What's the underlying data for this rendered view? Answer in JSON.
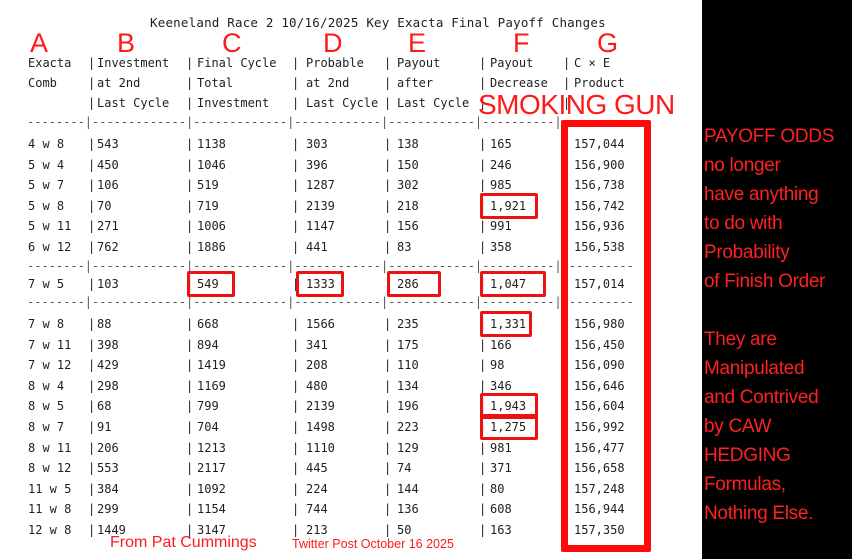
{
  "title": "Keeneland Race 2 10/16/2025 Key Exacta Final Payoff Changes",
  "letters": [
    "A",
    "B",
    "C",
    "D",
    "E",
    "F",
    "G"
  ],
  "headers": [
    [
      "Exacta",
      "Comb",
      ""
    ],
    [
      "Investment",
      "at 2nd",
      "Last Cycle"
    ],
    [
      "Final Cycle",
      "Total",
      "Investment"
    ],
    [
      "Probable",
      "at 2nd",
      "Last Cycle"
    ],
    [
      "Payout",
      "after",
      "Last Cycle"
    ],
    [
      "Payout",
      "Decrease",
      ""
    ],
    [
      "C × E",
      "Product",
      ""
    ]
  ],
  "separator": "--------|-------------|-------------|------------|------------|----------|----------",
  "groups": [
    [
      [
        "4 w 8",
        "543",
        "1138",
        "303",
        "138",
        "165",
        "157,044"
      ],
      [
        "5 w 4",
        "450",
        "1046",
        "396",
        "150",
        "246",
        "156,900"
      ],
      [
        "5 w 7",
        "106",
        "519",
        "1287",
        "302",
        "985",
        "156,738"
      ],
      [
        "5 w 8",
        "70",
        "719",
        "2139",
        "218",
        "1,921",
        "156,742"
      ],
      [
        "5 w 11",
        "271",
        "1006",
        "1147",
        "156",
        "991",
        "156,936"
      ],
      [
        "6 w 12",
        "762",
        "1886",
        "441",
        "83",
        "358",
        "156,538"
      ]
    ],
    [
      [
        "7 w 5",
        "103",
        "549",
        "1333",
        "286",
        "1,047",
        "157,014"
      ]
    ],
    [
      [
        "7 w 8",
        "88",
        "668",
        "1566",
        "235",
        "1,331",
        "156,980"
      ],
      [
        "7 w 11",
        "398",
        "894",
        "341",
        "175",
        "166",
        "156,450"
      ],
      [
        "7 w 12",
        "429",
        "1419",
        "208",
        "110",
        "98",
        "156,090"
      ],
      [
        "8 w 4",
        "298",
        "1169",
        "480",
        "134",
        "346",
        "156,646"
      ],
      [
        "8 w 5",
        "68",
        "799",
        "2139",
        "196",
        "1,943",
        "156,604"
      ],
      [
        "8 w 7",
        "91",
        "704",
        "1498",
        "223",
        "1,275",
        "156,992"
      ],
      [
        "8 w 11",
        "206",
        "1213",
        "1110",
        "129",
        "981",
        "156,477"
      ],
      [
        "8 w 12",
        "553",
        "2117",
        "445",
        "74",
        "371",
        "156,658"
      ],
      [
        "11 w 5",
        "384",
        "1092",
        "224",
        "144",
        "80",
        "157,248"
      ],
      [
        "11 w 8",
        "299",
        "1154",
        "744",
        "136",
        "608",
        "156,944"
      ],
      [
        "12 w 8",
        "1449",
        "3147",
        "213",
        "50",
        "163",
        "157,350"
      ]
    ]
  ],
  "smoking_gun": "SMOKING GUN",
  "side_text": [
    "PAYOFF ODDS",
    "no longer",
    "have anything",
    "to do with",
    "Probability",
    "of Finish Order",
    "",
    "They are",
    "Manipulated",
    "and Contrived",
    "by CAW",
    "HEDGING",
    "Formulas,",
    "Nothing Else."
  ],
  "footer": {
    "credit": "From Pat Cummings",
    "source": "Twitter Post October 16 2025"
  },
  "colors": {
    "annotation_red": "#ff1a1a",
    "paper": "#ffffff",
    "background": "#000000"
  }
}
